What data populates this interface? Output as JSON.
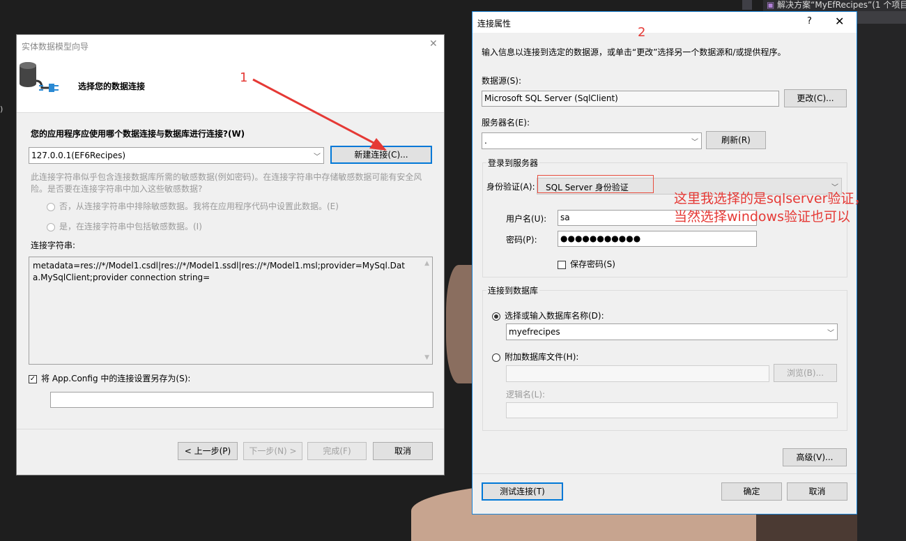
{
  "background": {
    "solution_explorer": "解决方案“MyEfRecipes”(1 个项目",
    "left_edge_char": ")"
  },
  "wizard": {
    "title": "实体数据模型向导",
    "heading": "选择您的数据连接",
    "question": "您的应用程序应使用哪个数据连接与数据库进行连接?(W)",
    "connection_selected": "127.0.0.1(EF6Recipes)",
    "new_connection_button": "新建连接(C)...",
    "sensitive_info": "此连接字符串似乎包含连接数据库所需的敏感数据(例如密码)。在连接字符串中存储敏感数据可能有安全风险。是否要在连接字符串中加入这些敏感数据?",
    "radio_no": "否，从连接字符串中排除敏感数据。我将在应用程序代码中设置此数据。(E)",
    "radio_yes": "是，在连接字符串中包括敏感数据。(I)",
    "connection_string_label": "连接字符串:",
    "connection_string": "metadata=res://*/Model1.csdl|res://*/Model1.ssdl|res://*/Model1.msl;provider=MySql.Data.MySqlClient;provider connection string=",
    "save_checkbox_label": "将 App.Config 中的连接设置另存为(S):",
    "save_checkbox_checked": true,
    "save_name_value": "",
    "back_button": "< 上一步(P)",
    "next_button": "下一步(N) >",
    "finish_button": "完成(F)",
    "cancel_button": "取消"
  },
  "connection_properties": {
    "title": "连接属性",
    "help_glyph": "?",
    "description": "输入信息以连接到选定的数据源，或单击“更改”选择另一个数据源和/或提供程序。",
    "data_source_label": "数据源(S):",
    "data_source_value": "Microsoft SQL Server (SqlClient)",
    "change_button": "更改(C)...",
    "server_name_label": "服务器名(E):",
    "server_name_value": ".",
    "refresh_button": "刷新(R)",
    "login_group_title": "登录到服务器",
    "auth_label": "身份验证(A):",
    "auth_value": "SQL Server 身份验证",
    "username_label": "用户名(U):",
    "username_value": "sa",
    "password_label": "密码(P):",
    "password_value": "●●●●●●●●●●●",
    "save_password_label": "保存密码(S)",
    "save_password_checked": false,
    "db_group_title": "连接到数据库",
    "select_db_radio": "选择或输入数据库名称(D):",
    "select_db_value": "myefrecipes",
    "attach_radio": "附加数据库文件(H):",
    "attach_value": "",
    "browse_button": "浏览(B)...",
    "logical_name_label": "逻辑名(L):",
    "logical_name_value": "",
    "advanced_button": "高级(V)...",
    "test_button": "测试连接(T)",
    "ok_button": "确定",
    "cancel_button": "取消"
  },
  "annotations": {
    "marker_1": "1",
    "marker_2": "2",
    "note_line1": "这里我选择的是sqlserver验证，",
    "note_line2": "当然选择windows验证也可以",
    "note_color": "#e53935"
  }
}
